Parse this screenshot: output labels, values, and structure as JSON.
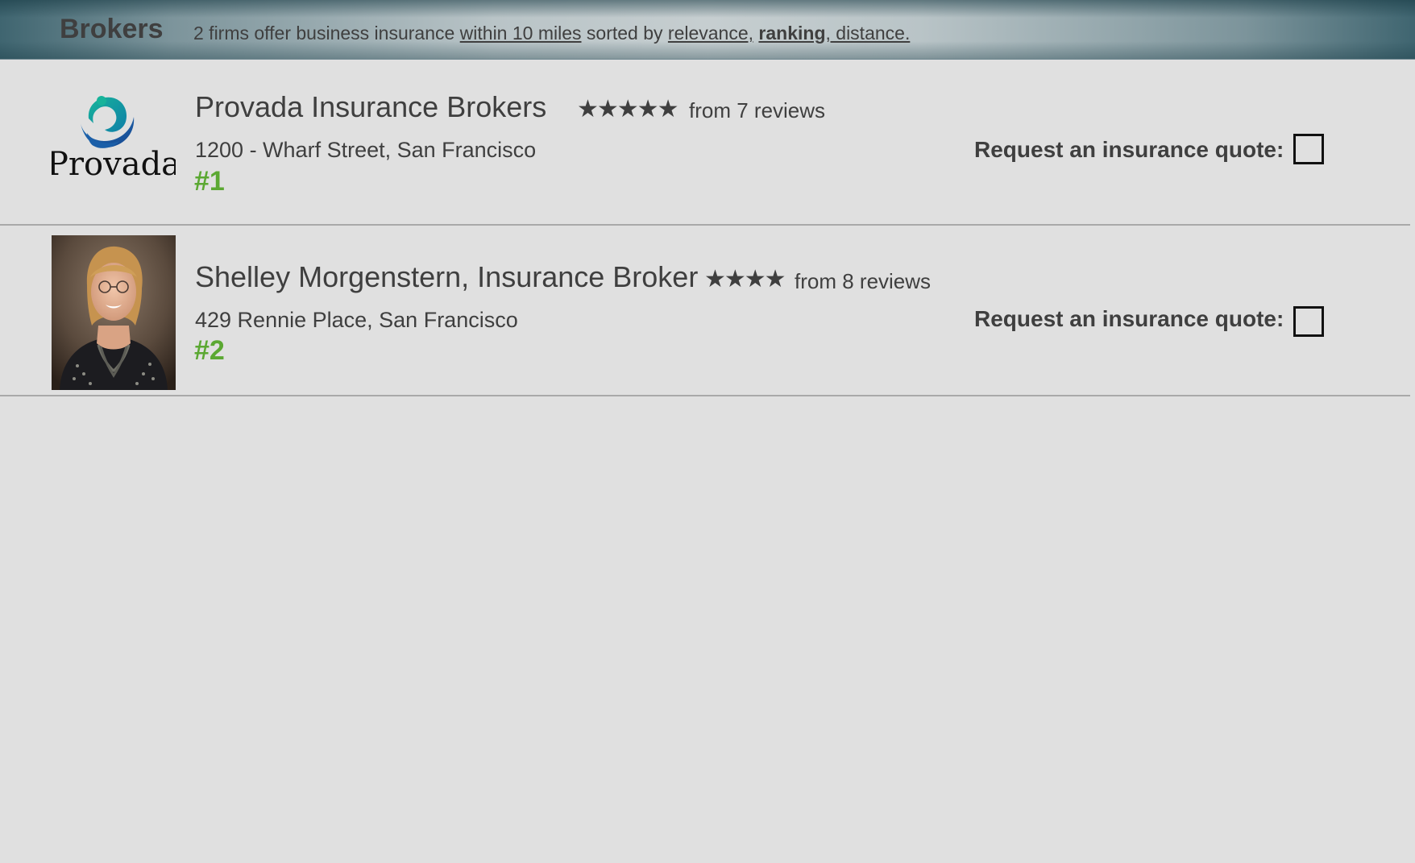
{
  "header": {
    "title": "Brokers",
    "summary_prefix": "2 firms offer business insurance ",
    "distance_link": "within 10 miles",
    "summary_middle": " sorted by ",
    "sort_relevance": "relevance,",
    "sort_ranking": "ranking",
    "sort_distance": ", distance."
  },
  "brokers": [
    {
      "name": "Provada Insurance Brokers",
      "logo_text": "Provada",
      "stars": "★★★★★",
      "rating": 5,
      "reviews": "from 7 reviews",
      "address": "1200 - Wharf Street, San Francisco",
      "rank": "#1",
      "quote_label": "Request an insurance quote:"
    },
    {
      "name": "Shelley Morgenstern, Insurance Broker",
      "stars": "★★★★",
      "rating": 4,
      "reviews": "from 8 reviews",
      "address": "429 Rennie Place, San Francisco",
      "rank": "#2",
      "quote_label": "Request an insurance quote:"
    }
  ],
  "colors": {
    "rank": "#5ba832",
    "text": "#3f3f3f",
    "background": "#e0e0e0"
  }
}
